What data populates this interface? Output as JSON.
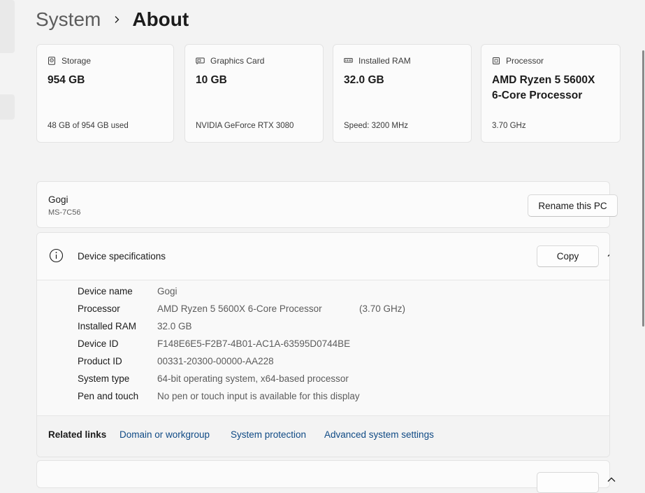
{
  "breadcrumb": {
    "parent": "System",
    "current": "About"
  },
  "cards": [
    {
      "icon": "storage-icon",
      "label": "Storage",
      "value": "954 GB",
      "sub": "48 GB of 954 GB used"
    },
    {
      "icon": "graphics-card-icon",
      "label": "Graphics Card",
      "value": "10 GB",
      "sub": "NVIDIA GeForce RTX 3080"
    },
    {
      "icon": "ram-icon",
      "label": "Installed RAM",
      "value": "32.0 GB",
      "sub": "Speed: 3200 MHz"
    },
    {
      "icon": "processor-icon",
      "label": "Processor",
      "value": "AMD Ryzen 5 5600X 6-Core Processor",
      "sub": "3.70 GHz"
    }
  ],
  "pc": {
    "name": "Gogi",
    "model": "MS-7C56",
    "rename_label": "Rename this PC"
  },
  "specs": {
    "title": "Device specifications",
    "copy_label": "Copy",
    "rows": [
      {
        "label": "Device name",
        "value": "Gogi"
      },
      {
        "label": "Processor",
        "value": "AMD Ryzen 5 5600X 6-Core Processor",
        "extra": "(3.70 GHz)"
      },
      {
        "label": "Installed RAM",
        "value": "32.0 GB"
      },
      {
        "label": "Device ID",
        "value": "F148E6E5-F2B7-4B01-AC1A-63595D0744BE"
      },
      {
        "label": "Product ID",
        "value": "00331-20300-00000-AA228"
      },
      {
        "label": "System type",
        "value": "64-bit operating system, x64-based processor"
      },
      {
        "label": "Pen and touch",
        "value": "No pen or touch input is available for this display"
      }
    ]
  },
  "related": {
    "label": "Related links",
    "links": [
      "Domain or workgroup",
      "System protection",
      "Advanced system settings"
    ]
  },
  "colors": {
    "link": "#0f4a85",
    "background": "#f3f3f3",
    "card": "#fbfbfb"
  }
}
